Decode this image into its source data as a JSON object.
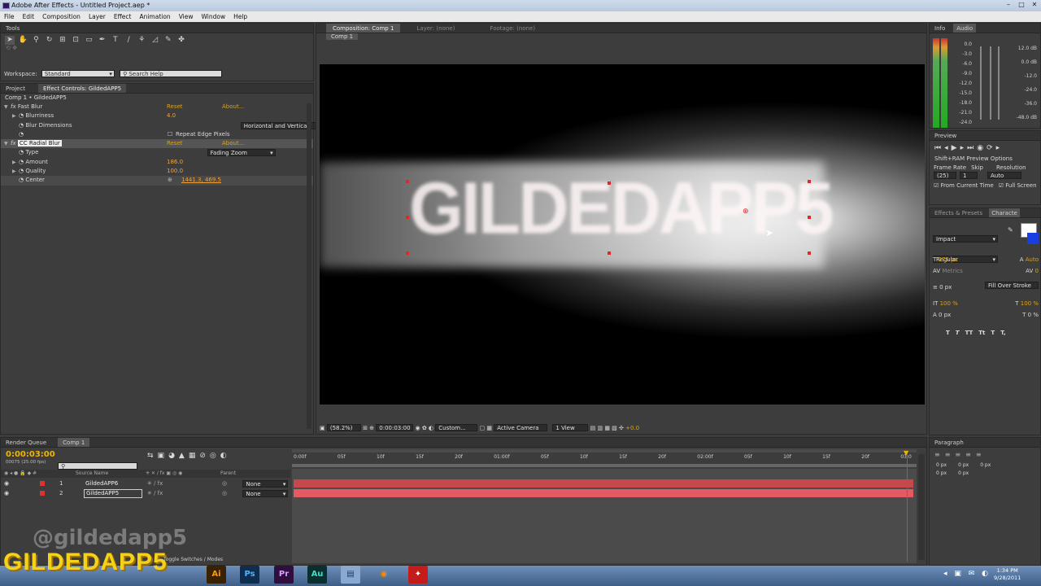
{
  "app": {
    "title": "Adobe After Effects - Untitled Project.aep *"
  },
  "window_controls": {
    "minimize": "–",
    "maximize": "□",
    "close": "✕"
  },
  "menu": [
    "File",
    "Edit",
    "Composition",
    "Layer",
    "Effect",
    "Animation",
    "View",
    "Window",
    "Help"
  ],
  "tools_panel": {
    "label": "Tools",
    "workspace_label": "Workspace:",
    "workspace_value": "Standard",
    "search_placeholder": "Search Help"
  },
  "effect_controls": {
    "tab_project": "Project",
    "tab_effect": "Effect Controls: GildedAPP5",
    "breadcrumb": "Comp 1 • GildedAPP5",
    "fast_blur": {
      "name": "Fast Blur",
      "reset": "Reset",
      "about": "About...",
      "blurriness_label": "Blurriness",
      "blurriness_value": "4.0",
      "dimensions_label": "Blur Dimensions",
      "dimensions_value": "Horizontal and Vertical",
      "repeat_label": "Repeat Edge Pixels"
    },
    "radial_blur": {
      "name": "CC Radial Blur",
      "reset": "Reset",
      "about": "About...",
      "type_label": "Type",
      "type_value": "Fading Zoom",
      "amount_label": "Amount",
      "amount_value": "186.0",
      "quality_label": "Quality",
      "quality_value": "100.0",
      "center_label": "Center",
      "center_value": "1441.3, 469.5"
    }
  },
  "composition": {
    "tab_comp": "Composition: Comp 1",
    "tab_layer": "Layer: (none)",
    "tab_footage": "Footage: (none)",
    "subtab": "Comp 1",
    "viewer_text": "GILDEDAPP5",
    "footer": {
      "zoom": "(58.2%)",
      "timecode": "0:00:03:00",
      "resolution": "Custom...",
      "camera": "Active Camera",
      "views": "1 View",
      "exposure": "+0.0"
    }
  },
  "info_audio": {
    "tab_info": "Info",
    "tab_audio": "Audio",
    "left_scale": [
      "0.0",
      "-3.0",
      "-6.0",
      "-9.0",
      "-12.0",
      "-15.0",
      "-18.0",
      "-21.0",
      "-24.0"
    ],
    "right_scale": [
      "12.0 dB",
      "0.0 dB",
      "-12.0",
      "-24.0",
      "-36.0",
      "-48.0 dB"
    ]
  },
  "preview": {
    "label": "Preview",
    "options": "Shift+RAM Preview Options",
    "frame_rate_label": "Frame Rate",
    "skip_label": "Skip",
    "resolution_label": "Resolution",
    "frame_rate_value": "(25)",
    "skip_value": "1",
    "resolution_value": "Auto",
    "from_current": "From Current Time",
    "full_screen": "Full Screen"
  },
  "character": {
    "tab_effects": "Effects & Presets",
    "tab_character": "Characte",
    "font": "Impact",
    "style": "Regular",
    "size": "275 px",
    "leading": "Auto",
    "kerning": "Metrics",
    "tracking": "0",
    "stroke": "0 px",
    "stroke_mode": "Fill Over Stroke",
    "vscale": "100 %",
    "hscale": "100 %",
    "baseline": "0 px",
    "tsume": "0 %",
    "styles": [
      "T",
      "T",
      "TT",
      "Tt",
      "T",
      "T,"
    ]
  },
  "paragraph": {
    "label": "Paragraph",
    "values": [
      "0 px",
      "0 px",
      "0 px",
      "0 px",
      "0 px"
    ]
  },
  "timeline": {
    "tab_render": "Render Queue",
    "tab_comp": "Comp 1",
    "timecode": "0:00:03:00",
    "frame_info": "00075 (25.00 fps)",
    "col_source": "Source Name",
    "col_parent": "Parent",
    "ruler": [
      "0:00f",
      "05f",
      "10f",
      "15f",
      "20f",
      "01:00f",
      "05f",
      "10f",
      "15f",
      "20f",
      "02:00f",
      "05f",
      "10f",
      "15f",
      "20f",
      "03:0"
    ],
    "layers": [
      {
        "num": "1",
        "name": "GildedAPP6",
        "parent": "None"
      },
      {
        "num": "2",
        "name": "GildedAPP5",
        "parent": "None"
      }
    ],
    "toggle_label": "Toggle Switches / Modes"
  },
  "watermark": {
    "handle": "@gildedapp5",
    "logo": "GILDEDAPP5"
  },
  "taskbar": {
    "apps": [
      "Ai",
      "Ps",
      "Pr",
      "Au"
    ],
    "time": "1:34 PM",
    "date": "9/28/2011"
  },
  "colors": {
    "accent": "#f1a33b",
    "layer_bar": "#d9575d",
    "playhead": "#e03a3a",
    "titlebar": "#c6d4e8"
  }
}
